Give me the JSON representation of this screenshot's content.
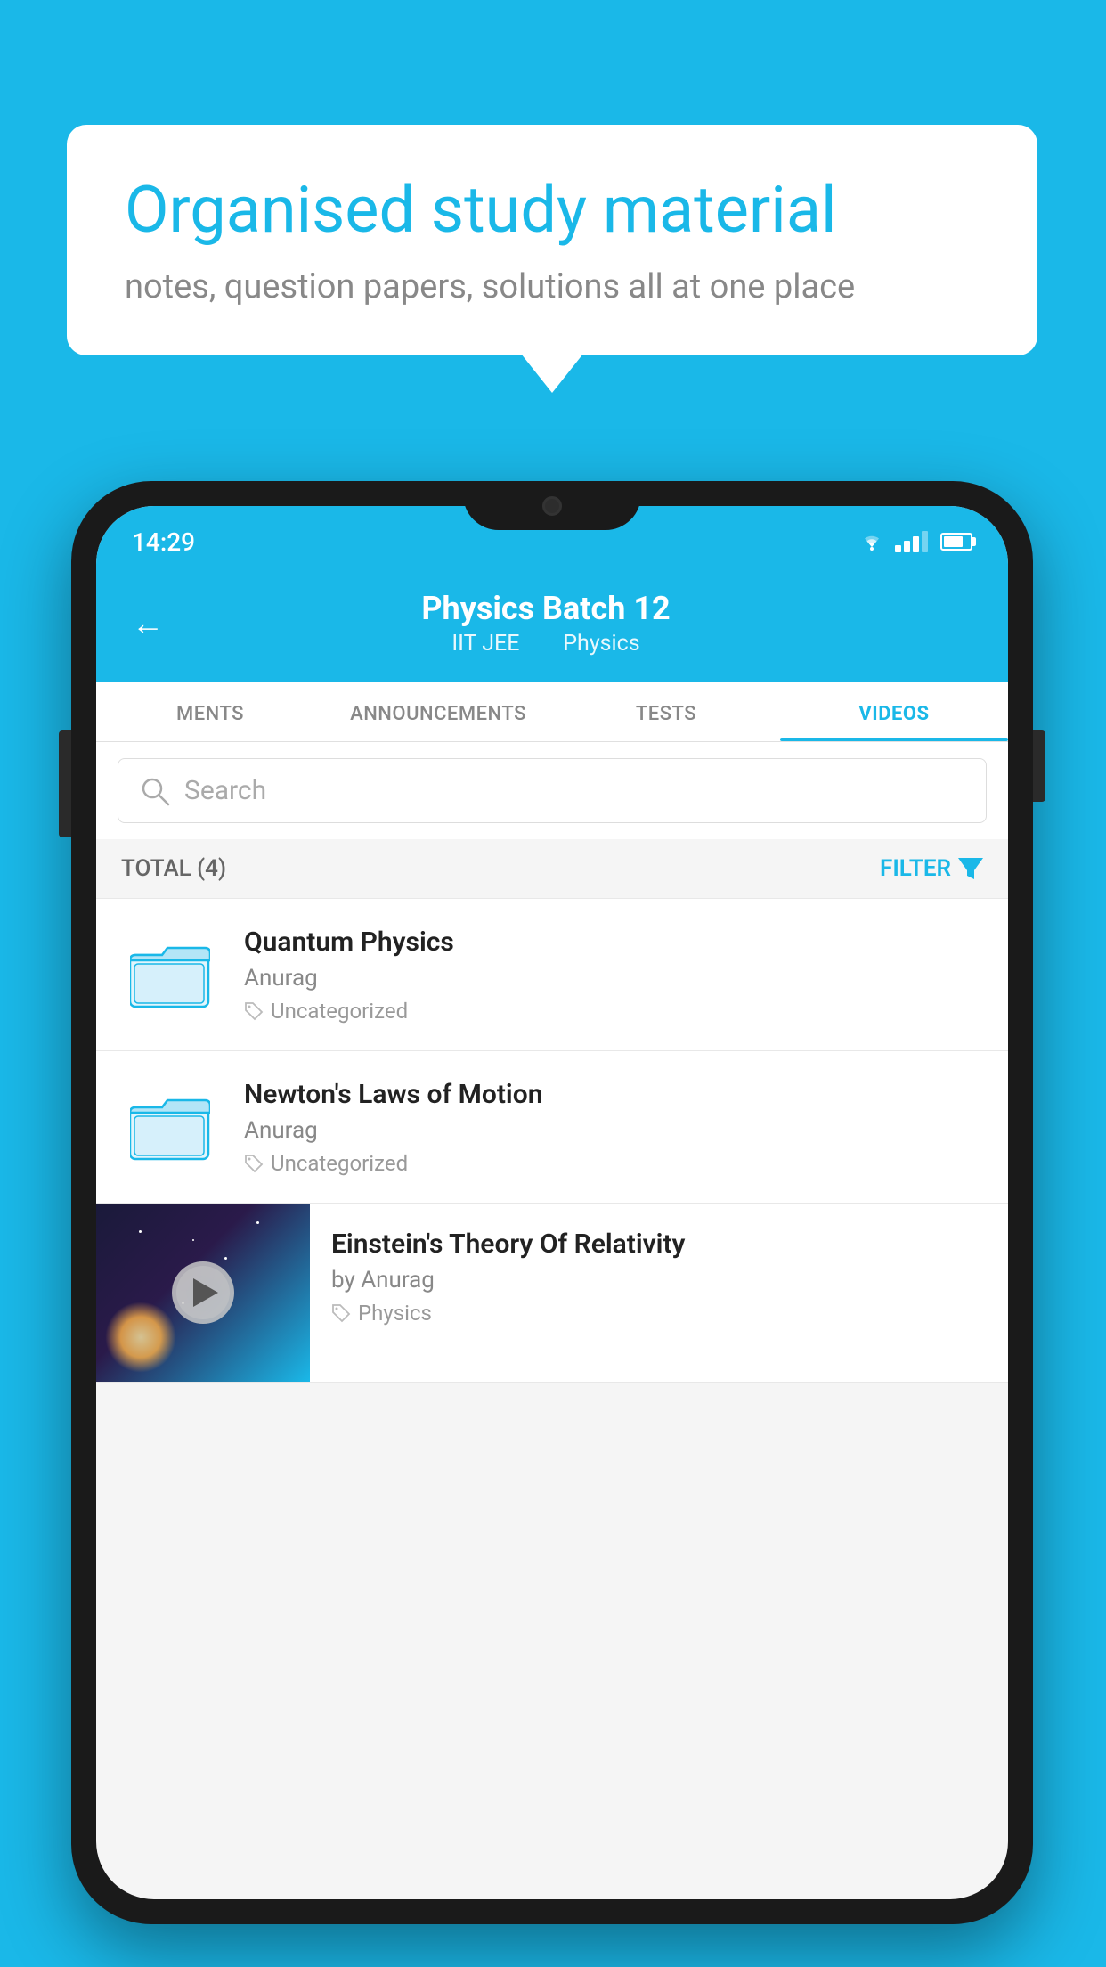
{
  "background_color": "#1ab8e8",
  "speech_bubble": {
    "title": "Organised study material",
    "subtitle": "notes, question papers, solutions all at one place"
  },
  "status_bar": {
    "time": "14:29"
  },
  "header": {
    "title": "Physics Batch 12",
    "subtitle_part1": "IIT JEE",
    "subtitle_part2": "Physics",
    "back_label": "←"
  },
  "tabs": [
    {
      "label": "MENTS",
      "active": false
    },
    {
      "label": "ANNOUNCEMENTS",
      "active": false
    },
    {
      "label": "TESTS",
      "active": false
    },
    {
      "label": "VIDEOS",
      "active": true
    }
  ],
  "search": {
    "placeholder": "Search"
  },
  "filter_bar": {
    "total_label": "TOTAL (4)",
    "filter_label": "FILTER"
  },
  "videos": [
    {
      "id": 1,
      "title": "Quantum Physics",
      "author": "Anurag",
      "tag": "Uncategorized",
      "has_thumbnail": false
    },
    {
      "id": 2,
      "title": "Newton's Laws of Motion",
      "author": "Anurag",
      "tag": "Uncategorized",
      "has_thumbnail": false
    },
    {
      "id": 3,
      "title": "Einstein's Theory Of Relativity",
      "author": "by Anurag",
      "tag": "Physics",
      "has_thumbnail": true
    }
  ]
}
